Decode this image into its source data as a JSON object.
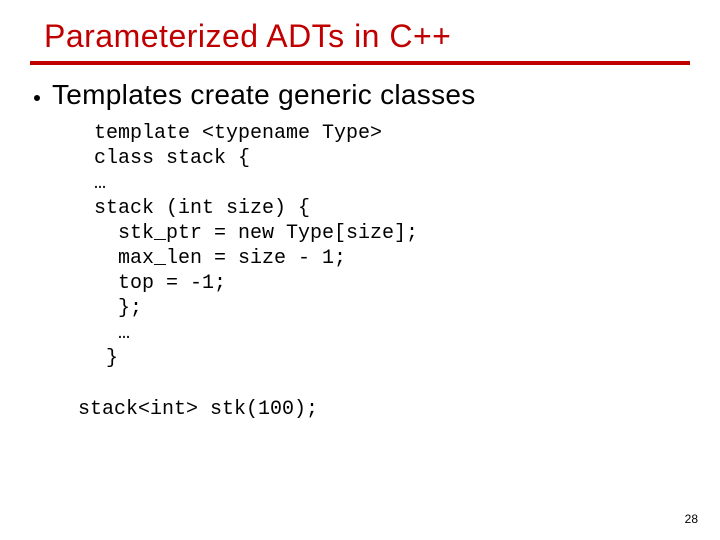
{
  "title": "Parameterized ADTs in C++",
  "bullet": "Templates create generic classes",
  "code1": "template <typename Type>\nclass stack {\n…\nstack (int size) {\n  stk_ptr = new Type[size];\n  max_len = size - 1;\n  top = -1;\n  };\n  …\n }",
  "code2": "stack<int> stk(100);",
  "page_number": "28"
}
